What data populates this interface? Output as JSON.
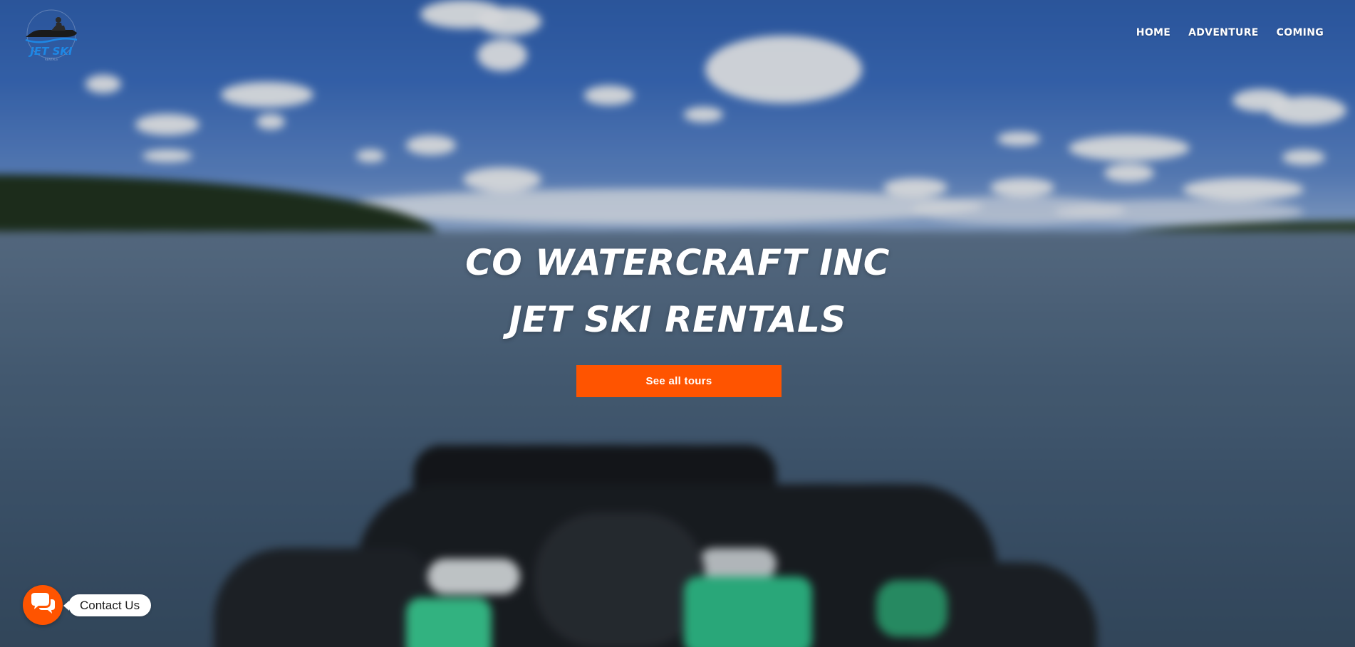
{
  "logo": {
    "text": "JET SKI",
    "ring_text": "CO WATERCRAFT INC",
    "sub_text": "RENTALS"
  },
  "nav": {
    "items": [
      {
        "label": "HOME"
      },
      {
        "label": "ADVENTURE"
      },
      {
        "label": "COMING"
      }
    ]
  },
  "hero": {
    "title_line1": "CO WATERCRAFT INC",
    "title_line2": "JET SKI RENTALS",
    "cta_label": "See all tours"
  },
  "contact": {
    "label": "Contact Us",
    "icon": "chat-bubbles-icon"
  },
  "colors": {
    "accent": "#ff5400",
    "text_light": "#ffffff",
    "logo_blue": "#1e88e5"
  }
}
